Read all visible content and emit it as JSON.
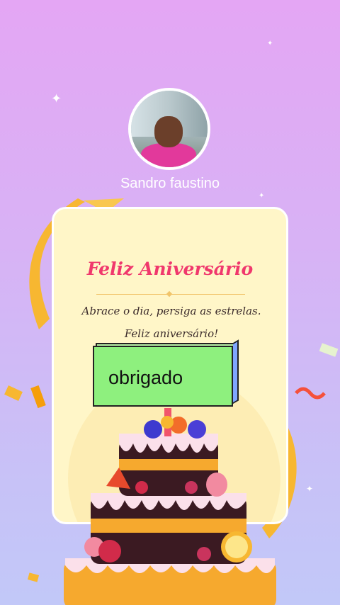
{
  "profile": {
    "name": "Sandro faustino"
  },
  "card": {
    "title": "Feliz Aniversário",
    "message": "Abrace o dia, persiga as estrelas. Feliz aniversário!"
  },
  "reply": {
    "text": "obrigado"
  },
  "colors": {
    "background_top": "#e4a6f4",
    "background_bottom": "#c2c8f8",
    "card": "#fff6c8",
    "title": "#f0386d",
    "reply_button": "#8ef07e",
    "reply_side": "#7fa6ff"
  }
}
